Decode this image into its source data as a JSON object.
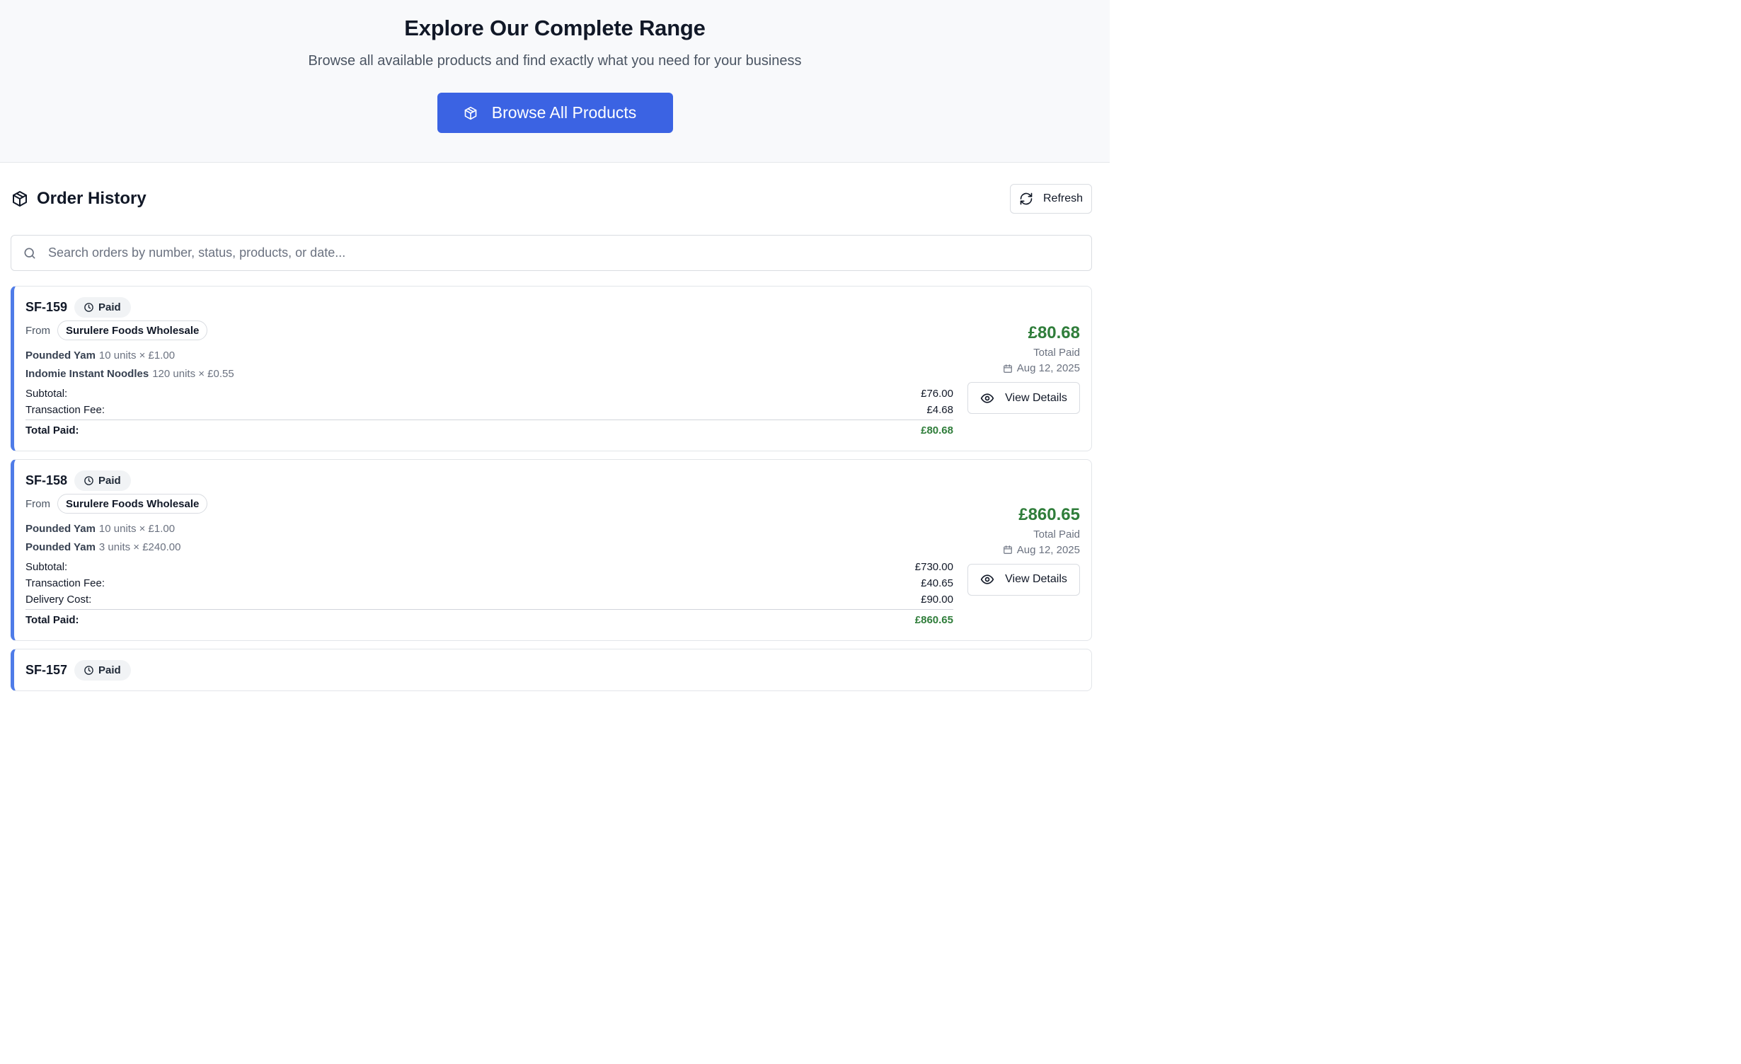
{
  "hero": {
    "title": "Explore Our Complete Range",
    "subtitle": "Browse all available products and find exactly what you need for your business",
    "button_label": "Browse All Products"
  },
  "order_history": {
    "title": "Order History",
    "refresh_label": "Refresh",
    "search_placeholder": "Search orders by number, status, products, or date..."
  },
  "labels": {
    "from": "From",
    "subtotal": "Subtotal:",
    "transaction_fee": "Transaction Fee:",
    "delivery_cost": "Delivery Cost:",
    "total_paid": "Total Paid:",
    "total_paid_side": "Total Paid",
    "view_details": "View Details"
  },
  "colors": {
    "accent": "#3b63e3",
    "card_border_accent": "#4f7ce8",
    "amount_green": "#2f7d3a"
  },
  "orders": [
    {
      "id": "SF-159",
      "status": "Paid",
      "vendor": "Surulere Foods Wholesale",
      "items": [
        {
          "name": "Pounded Yam",
          "qty": "10 units × £1.00"
        },
        {
          "name": "Indomie Instant Noodles",
          "qty": "120 units × £0.55"
        }
      ],
      "subtotal": "£76.00",
      "transaction_fee": "£4.68",
      "total": "£80.68",
      "date": "Aug 12, 2025"
    },
    {
      "id": "SF-158",
      "status": "Paid",
      "vendor": "Surulere Foods Wholesale",
      "items": [
        {
          "name": "Pounded Yam",
          "qty": "10 units × £1.00"
        },
        {
          "name": "Pounded Yam",
          "qty": "3 units × £240.00"
        }
      ],
      "subtotal": "£730.00",
      "transaction_fee": "£40.65",
      "delivery_cost": "£90.00",
      "total": "£860.65",
      "date": "Aug 12, 2025"
    },
    {
      "id": "SF-157",
      "status": "Paid"
    }
  ]
}
